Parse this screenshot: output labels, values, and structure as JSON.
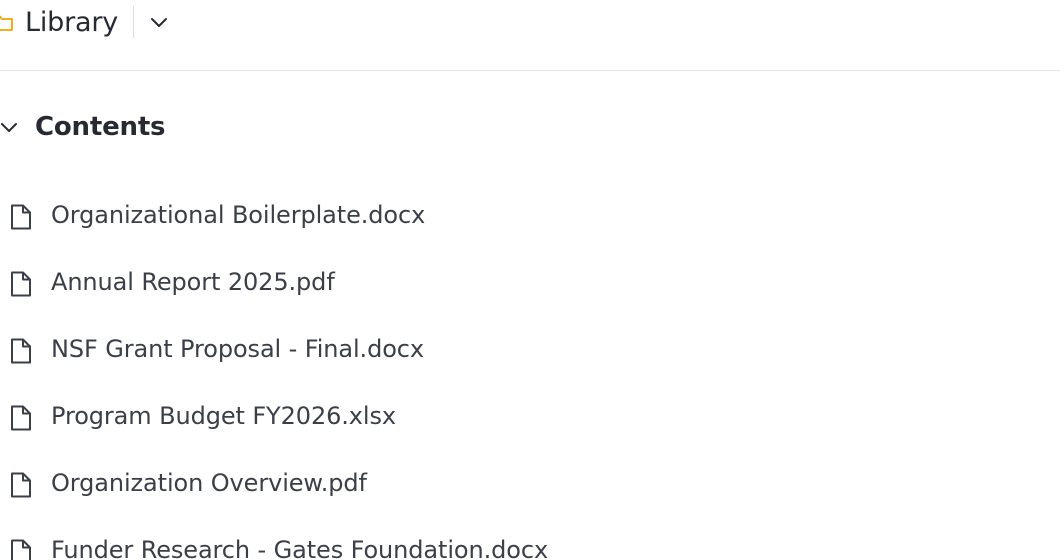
{
  "header": {
    "title": "Library",
    "folder_icon": "folder-icon",
    "menu_icon": "chevron-down-icon",
    "accent_color": "#f0a500"
  },
  "section": {
    "title": "Contents",
    "toggle_icon": "chevron-down-icon",
    "expanded": true
  },
  "files": [
    {
      "name": "Organizational Boilerplate.docx",
      "icon": "file-icon"
    },
    {
      "name": "Annual Report 2025.pdf",
      "icon": "file-icon"
    },
    {
      "name": "NSF Grant Proposal - Final.docx",
      "icon": "file-icon"
    },
    {
      "name": "Program Budget FY2026.xlsx",
      "icon": "file-icon"
    },
    {
      "name": "Organization Overview.pdf",
      "icon": "file-icon"
    },
    {
      "name": "Funder Research - Gates Foundation.docx",
      "icon": "file-icon"
    }
  ]
}
